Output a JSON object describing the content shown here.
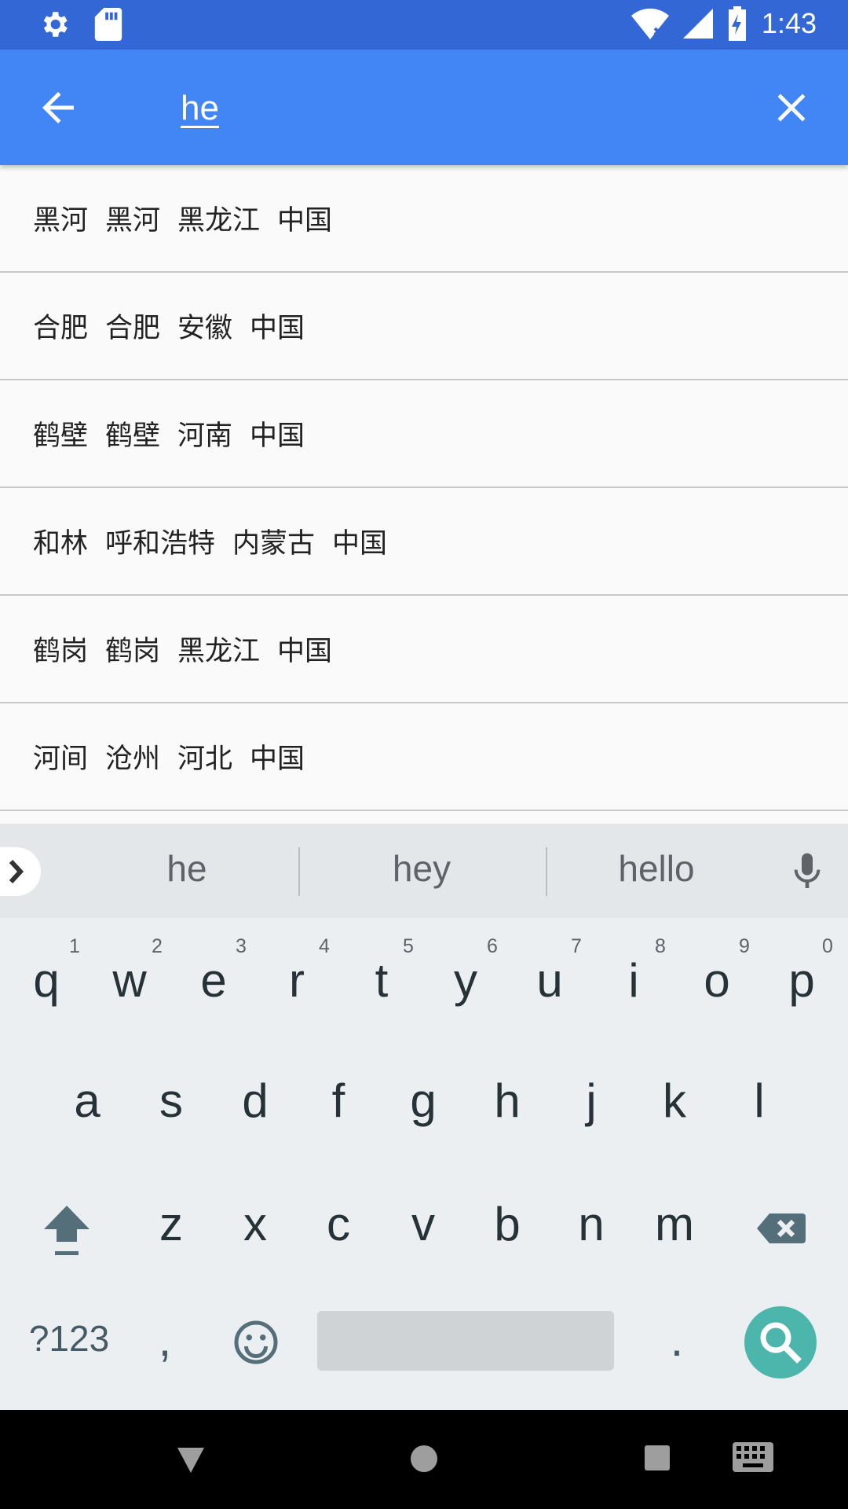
{
  "status_bar": {
    "time": "1:43",
    "icons": [
      "settings-icon",
      "sd-card-icon",
      "wifi-icon",
      "signal-icon",
      "battery-charging-icon"
    ]
  },
  "app_bar": {
    "query": "he",
    "back_icon": "arrow-back-icon",
    "clear_icon": "close-icon"
  },
  "results": [
    [
      "黑河",
      "黑河",
      "黑龙江",
      "中国"
    ],
    [
      "合肥",
      "合肥",
      "安徽",
      "中国"
    ],
    [
      "鹤壁",
      "鹤壁",
      "河南",
      "中国"
    ],
    [
      "和林",
      "呼和浩特",
      "内蒙古",
      "中国"
    ],
    [
      "鹤岗",
      "鹤岗",
      "黑龙江",
      "中国"
    ],
    [
      "河间",
      "沧州",
      "河北",
      "中国"
    ]
  ],
  "keyboard": {
    "suggestions": [
      "he",
      "hey",
      "hello"
    ],
    "row1": [
      "q",
      "w",
      "e",
      "r",
      "t",
      "y",
      "u",
      "i",
      "o",
      "p"
    ],
    "row1_hints": [
      "1",
      "2",
      "3",
      "4",
      "5",
      "6",
      "7",
      "8",
      "9",
      "0"
    ],
    "row2": [
      "a",
      "s",
      "d",
      "f",
      "g",
      "h",
      "j",
      "k",
      "l"
    ],
    "row3": [
      "z",
      "x",
      "c",
      "v",
      "b",
      "n",
      "m"
    ],
    "symbols_label": "?123",
    "comma": ",",
    "period": "."
  },
  "nav_bar": {
    "icons": [
      "back-triangle-icon",
      "home-circle-icon",
      "recents-square-icon",
      "keyboard-icon"
    ]
  }
}
